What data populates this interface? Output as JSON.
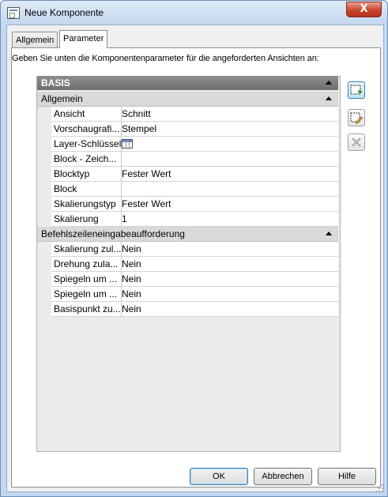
{
  "window": {
    "title": "Neue Komponente",
    "close_label": "X"
  },
  "tabs": [
    {
      "label": "Allgemein",
      "active": false
    },
    {
      "label": "Parameter",
      "active": true
    }
  ],
  "description": "Geben Sie unten die Komponentenparameter für die angeforderten Ansichten an:",
  "grid": {
    "category": "BASIS",
    "groups": [
      {
        "title": "Allgemein",
        "rows": [
          {
            "name": "Ansicht",
            "value": "Schnitt"
          },
          {
            "name": "Vorschaugrafi...",
            "value": "Stempel"
          },
          {
            "name": "Layer-Schlüssel",
            "value": "",
            "icon": "table-icon"
          },
          {
            "name": "Block - Zeich...",
            "value": ""
          },
          {
            "name": "Blocktyp",
            "value": "Fester Wert"
          },
          {
            "name": "Block",
            "value": ""
          },
          {
            "name": "Skalierungstyp",
            "value": "Fester Wert"
          },
          {
            "name": "Skalierung",
            "value": "1"
          }
        ]
      },
      {
        "title": "Befehlszeileneingabeaufforderung",
        "rows": [
          {
            "name": "Skalierung zul...",
            "value": "Nein"
          },
          {
            "name": "Drehung zula...",
            "value": "Nein"
          },
          {
            "name": "Spiegeln um ...",
            "value": "Nein"
          },
          {
            "name": "Spiegeln um ...",
            "value": "Nein"
          },
          {
            "name": "Basispunkt zu...",
            "value": "Nein"
          }
        ]
      }
    ]
  },
  "side_buttons": [
    "add-view-icon",
    "edit-view-icon",
    "delete-view-icon"
  ],
  "buttons": {
    "ok": "OK",
    "cancel": "Abbrechen",
    "help": "Hilfe"
  }
}
